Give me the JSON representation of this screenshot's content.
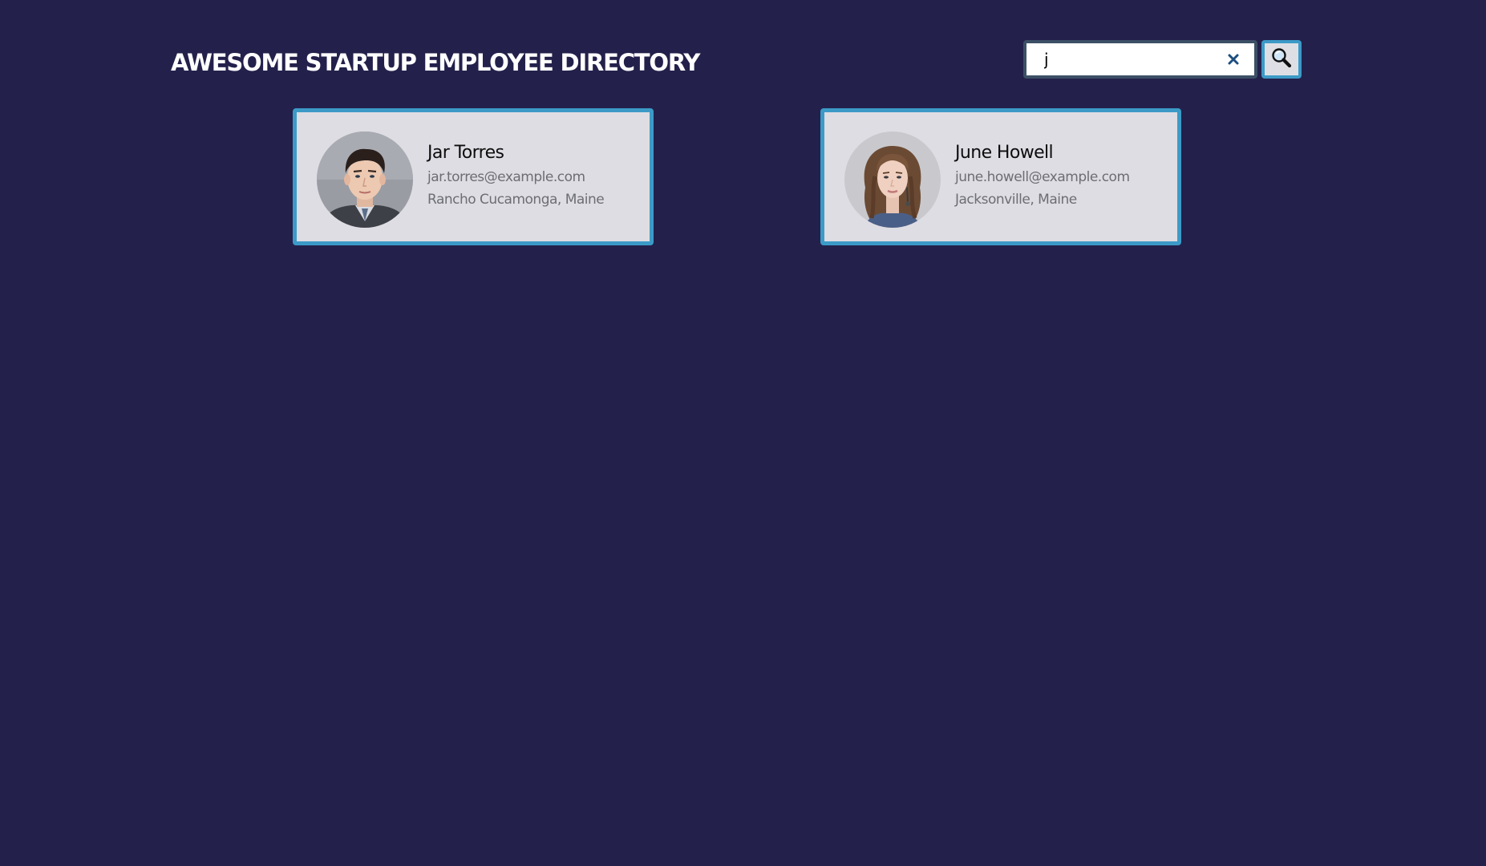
{
  "header": {
    "title": "AWESOME STARTUP EMPLOYEE DIRECTORY"
  },
  "search": {
    "value": "j",
    "clear_icon": "close-icon",
    "button_icon": "search-icon"
  },
  "colors": {
    "background": "#23214b",
    "card_background": "#dedde3",
    "card_border": "#3c9ac7",
    "accent": "#1c4e80"
  },
  "employees": [
    {
      "name": "Jar Torres",
      "email": "jar.torres@example.com",
      "location": "Rancho Cucamonga, Maine",
      "avatar": "man-portrait"
    },
    {
      "name": "June Howell",
      "email": "june.howell@example.com",
      "location": "Jacksonville, Maine",
      "avatar": "woman-portrait"
    }
  ]
}
